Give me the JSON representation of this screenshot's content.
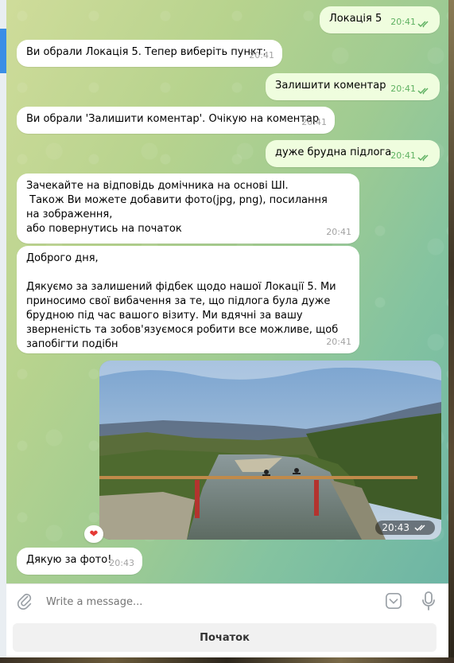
{
  "messages": [
    {
      "text": "Локація 5",
      "time": "20:41",
      "dir": "out"
    },
    {
      "text": "Ви обрали Локація 5. Тепер виберіть пункт:",
      "time": "20:41",
      "dir": "in"
    },
    {
      "text": "Залишити коментар",
      "time": "20:41",
      "dir": "out"
    },
    {
      "text": "Ви обрали 'Залишити коментар'. Очікую на коментар",
      "time": "20:41",
      "dir": "in"
    },
    {
      "text": "дуже брудна підлога",
      "time": "20:41",
      "dir": "out"
    },
    {
      "text": "Зачекайте на відповідь домічника на основі ШІ.\n Також Ви можете добавити фото(jpg, png), посилання на зображення,\nабо повернутись на початок",
      "time": "20:41",
      "dir": "in"
    },
    {
      "text": "Доброго дня,\n\nДякуємо за залишений фідбек щодо нашої Локації 5. Ми приносимо свої вибачення за те, що підлога була дуже брудною під час вашого візиту. Ми вдячні за вашу зверненість та зобов'язуємося робити все можливе, щоб запобігти подібн",
      "time": "20:41",
      "dir": "in"
    },
    {
      "text": "Дякую за фото!",
      "time": "20:43",
      "dir": "in"
    }
  ],
  "photo": {
    "time": "20:43",
    "reaction": "heart"
  },
  "composer": {
    "placeholder": "Write a message..."
  },
  "keyboard": {
    "button_label": "Початок"
  },
  "colors": {
    "outgoing_bubble": "#effdde",
    "incoming_bubble": "#ffffff",
    "accent": "#3a8ee6",
    "check": "#5fb162"
  },
  "icons": [
    "paperclip-icon",
    "sticker-icon",
    "microphone-icon",
    "double-check-icon",
    "heart-icon"
  ]
}
